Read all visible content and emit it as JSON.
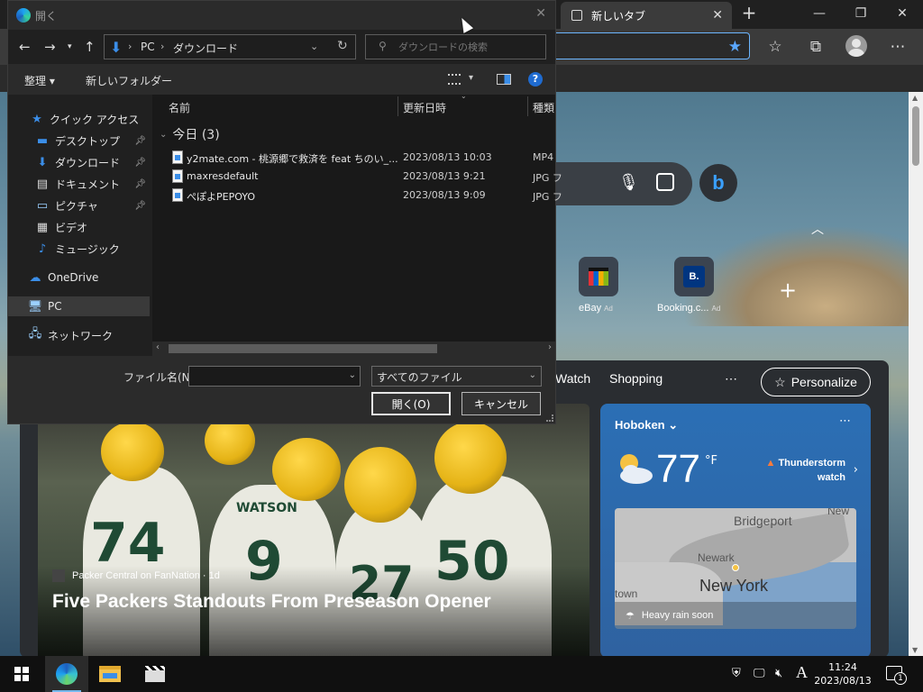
{
  "browser": {
    "tab_title": "新しいタブ",
    "feed": {
      "nav_items": [
        "Watch",
        "Shopping"
      ],
      "personalize_label": "Personalize",
      "hero": {
        "source": "Packer Central on FanNation · 1d",
        "title": "Five Packers Standouts From Preseason Opener"
      },
      "weather": {
        "location": "Hoboken",
        "temperature": "77",
        "unit": "°F",
        "alert_line1": "Thunderstorm",
        "alert_line2": "watch",
        "map_labels": [
          "Bridgeport",
          "Newark",
          "New York",
          "New",
          "town"
        ],
        "rain_note": "Heavy rain soon"
      }
    },
    "quick_links": [
      {
        "label": "eBay",
        "ad": "Ad"
      },
      {
        "label": "Booking.c...",
        "ad": "Ad",
        "tile_text": "B."
      }
    ]
  },
  "dialog": {
    "title": "開く",
    "breadcrumb": [
      "PC",
      "ダウンロード"
    ],
    "search_placeholder": "ダウンロードの検索",
    "commands": {
      "organize": "整理 ▾",
      "new_folder": "新しいフォルダー"
    },
    "nav_pane": [
      {
        "label": "クイック アクセス",
        "icon": "star-icon"
      },
      {
        "label": "デスクトップ",
        "icon": "desktop-icon",
        "pinned": true
      },
      {
        "label": "ダウンロード",
        "icon": "download-icon",
        "pinned": true
      },
      {
        "label": "ドキュメント",
        "icon": "document-icon",
        "pinned": true
      },
      {
        "label": "ピクチャ",
        "icon": "picture-icon",
        "pinned": true
      },
      {
        "label": "ビデオ",
        "icon": "video-icon"
      },
      {
        "label": "ミュージック",
        "icon": "music-icon"
      },
      {
        "label": "OneDrive",
        "icon": "cloud-icon"
      },
      {
        "label": "PC",
        "icon": "pc-icon",
        "selected": true
      },
      {
        "label": "ネットワーク",
        "icon": "network-icon"
      }
    ],
    "columns": {
      "name": "名前",
      "modified": "更新日時",
      "type": "種類"
    },
    "group": "今日 (3)",
    "files": [
      {
        "name": "y2mate.com - 桃源郷で救済を feat ちのい_...",
        "modified": "2023/08/13 10:03",
        "type": "MP4"
      },
      {
        "name": "maxresdefault",
        "modified": "2023/08/13 9:21",
        "type": "JPG フ"
      },
      {
        "name": "ぺぽよPEPOYO",
        "modified": "2023/08/13 9:09",
        "type": "JPG フ"
      }
    ],
    "file_name_label": "ファイル名(N):",
    "file_name_value": "",
    "file_type": "すべてのファイル",
    "open_label": "開く(O)",
    "cancel_label": "キャンセル"
  },
  "taskbar": {
    "ime": "A",
    "time": "11:24",
    "date": "2023/08/13",
    "notification_count": "1"
  }
}
